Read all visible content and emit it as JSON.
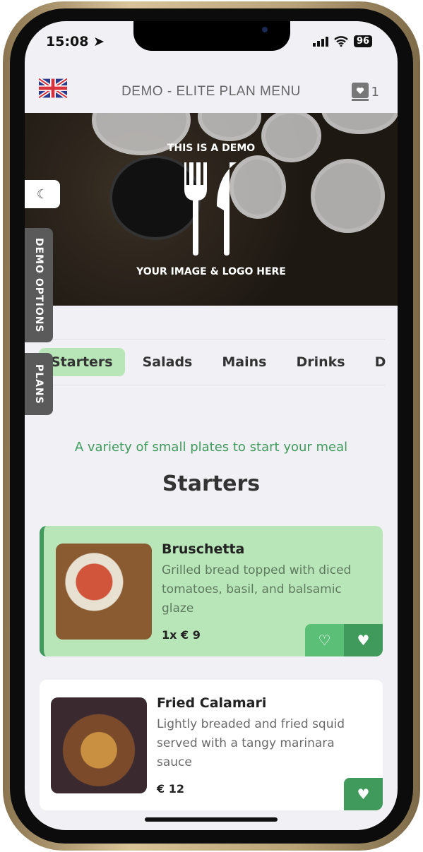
{
  "status_bar": {
    "time": "15:08",
    "battery": "96"
  },
  "header": {
    "title": "DEMO - ELITE PLAN MENU",
    "favorites_count": "1",
    "language": "English (UK)"
  },
  "hero": {
    "top_text": "THIS IS A DEMO",
    "bottom_text": "YOUR IMAGE & LOGO HERE"
  },
  "side_tabs": {
    "demo_options": "DEMO OPTIONS",
    "plans": "PLANS"
  },
  "tabs": [
    {
      "label": "Starters",
      "active": true
    },
    {
      "label": "Salads"
    },
    {
      "label": "Mains"
    },
    {
      "label": "Drinks"
    },
    {
      "label": "D"
    }
  ],
  "section": {
    "subtitle": "A variety of small plates to start your meal",
    "title": "Starters"
  },
  "items": [
    {
      "name": "Bruschetta",
      "description": "Grilled bread topped with diced tomatoes, basil, and balsamic glaze",
      "price": "1x € 9",
      "selected": true
    },
    {
      "name": "Fried Calamari",
      "description": "Lightly breaded and fried squid served with a tangy marinara sauce",
      "price": "€ 12",
      "selected": false
    }
  ],
  "colors": {
    "accent": "#3f9a5b",
    "selected_bg": "#b8e6b8",
    "light_btn": "#5cbf78"
  }
}
